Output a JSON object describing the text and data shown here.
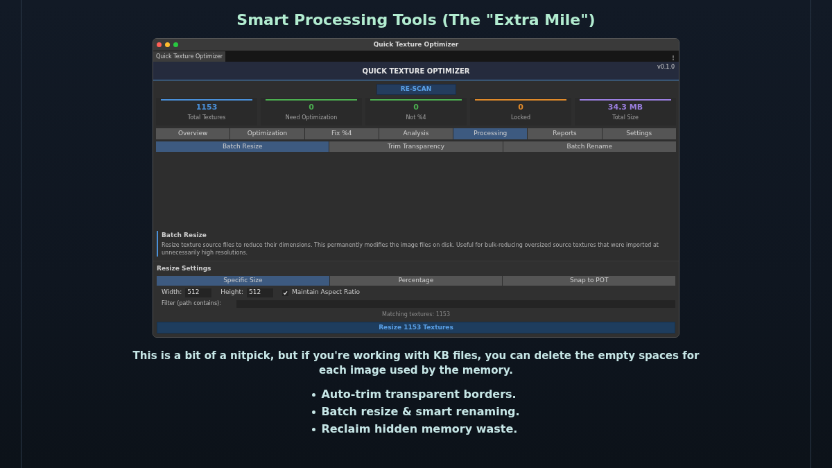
{
  "slide_title": "Smart Processing Tools (The \"Extra Mile\")",
  "window": {
    "title": "Quick Texture Optimizer",
    "tab": "Quick Texture Optimizer",
    "header": "QUICK TEXTURE OPTIMIZER",
    "version": "v0.1.0",
    "rescan": "RE-SCAN",
    "stats": [
      {
        "value": "1153",
        "label": "Total Textures",
        "color": "#4a90d9"
      },
      {
        "value": "0",
        "label": "Need Optimization",
        "color": "#4caf50"
      },
      {
        "value": "0",
        "label": "Not %4",
        "color": "#4caf50"
      },
      {
        "value": "0",
        "label": "Locked",
        "color": "#e08a2a"
      },
      {
        "value": "34.3 MB",
        "label": "Total Size",
        "color": "#9b7fe0"
      }
    ],
    "tabs": [
      {
        "label": "Overview",
        "selected": false
      },
      {
        "label": "Optimization",
        "selected": false
      },
      {
        "label": "Fix %4",
        "selected": false
      },
      {
        "label": "Analysis",
        "selected": false
      },
      {
        "label": "Processing",
        "selected": true
      },
      {
        "label": "Reports",
        "selected": false
      },
      {
        "label": "Settings",
        "selected": false
      }
    ],
    "subtabs": [
      {
        "label": "Batch Resize",
        "selected": true
      },
      {
        "label": "Trim Transparency",
        "selected": false
      },
      {
        "label": "Batch Rename",
        "selected": false
      }
    ],
    "info": {
      "title": "Batch Resize",
      "text": "Resize texture source files to reduce their dimensions. This permanently modifies the image files on disk. Useful for bulk-reducing oversized source textures that were imported at unnecessarily high resolutions."
    },
    "settings": {
      "heading": "Resize Settings",
      "modes": [
        {
          "label": "Specific Size",
          "selected": true
        },
        {
          "label": "Percentage",
          "selected": false
        },
        {
          "label": "Snap to POT",
          "selected": false
        }
      ],
      "width": {
        "label": "Width:",
        "value": "512"
      },
      "height": {
        "label": "Height:",
        "value": "512"
      },
      "aspect": {
        "label": "Maintain Aspect Ratio",
        "checked": true
      },
      "filter": {
        "label": "Filter (path contains):"
      },
      "matching": "Matching textures: 1153",
      "action": "Resize 1153 Textures"
    }
  },
  "paragraph": "This is a bit of a nitpick, but if you're working with KB files, you can delete the empty spaces for each image used by the memory.",
  "bullets": [
    "Auto-trim transparent borders.",
    "Batch resize & smart renaming.",
    "Reclaim hidden memory waste."
  ]
}
